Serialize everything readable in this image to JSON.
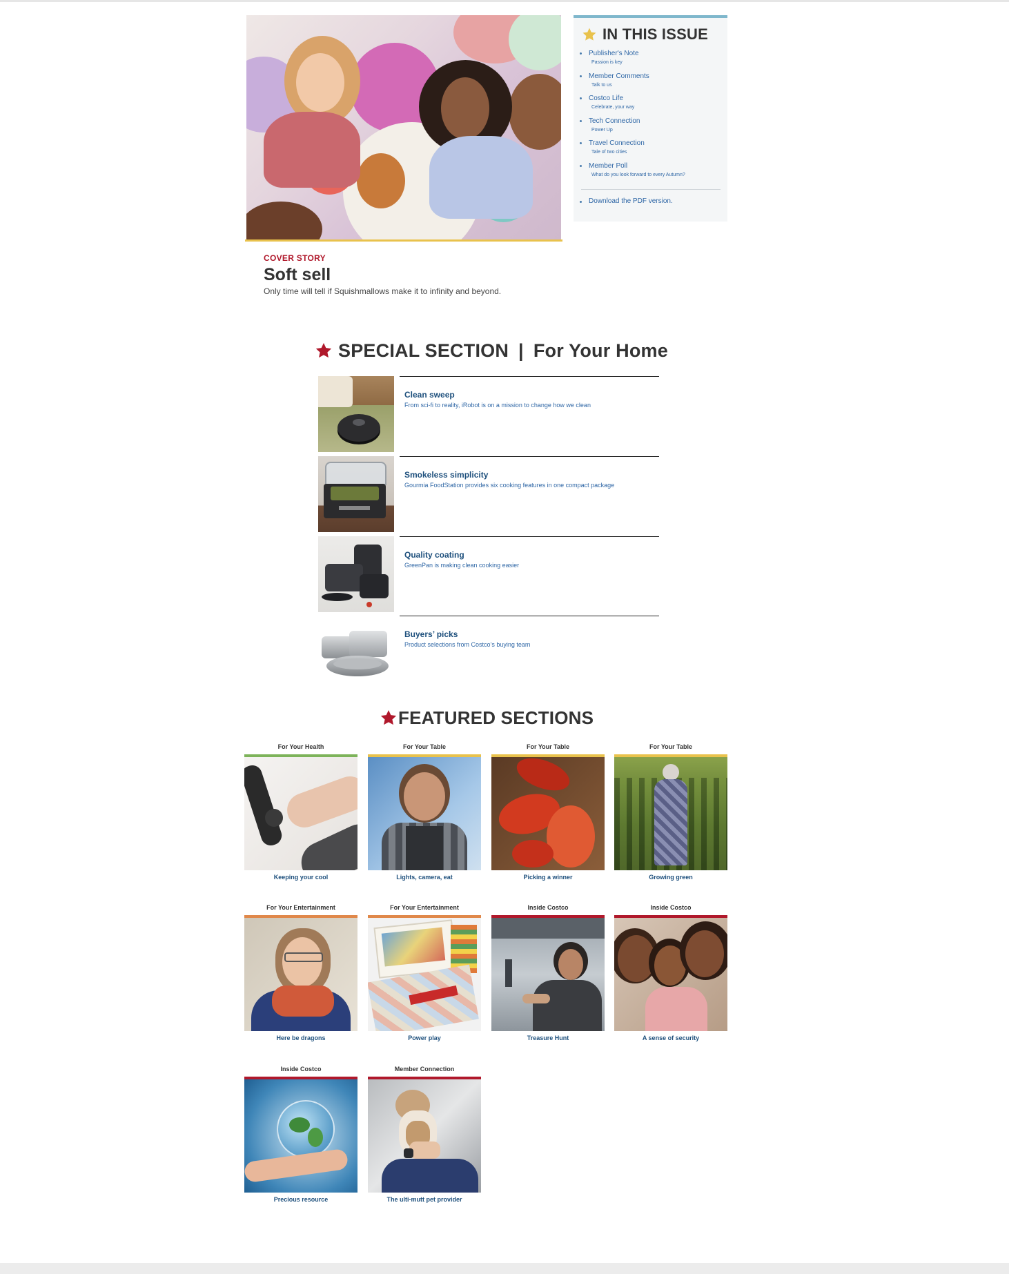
{
  "cover": {
    "label": "COVER STORY",
    "title": "Soft sell",
    "description": "Only time will tell if Squishmallows make it to infinity and beyond."
  },
  "issue": {
    "title": "IN THIS ISSUE",
    "items": [
      {
        "label": "Publisher's Note",
        "sub": "Passion is key"
      },
      {
        "label": "Member Comments",
        "sub": "Talk to us"
      },
      {
        "label": "Costco Life",
        "sub": "Celebrate, your way"
      },
      {
        "label": "Tech Connection",
        "sub": "Power Up"
      },
      {
        "label": "Travel Connection",
        "sub": "Tale of two cities"
      },
      {
        "label": "Member Poll",
        "sub": "What do you look forward to every Autumn?"
      }
    ],
    "pdf_link": "Download the PDF version."
  },
  "special": {
    "title_left": "SPECIAL SECTION",
    "separator": "|",
    "title_right": "For Your Home",
    "items": [
      {
        "title": "Clean sweep",
        "description": "From sci-fi to reality, iRobot is on a mission to change how we clean"
      },
      {
        "title": "Smokeless simplicity",
        "description": "Gourmia FoodStation provides six cooking features in one compact package"
      },
      {
        "title": "Quality coating",
        "description": "GreenPan is making clean cooking easier"
      },
      {
        "title": "Buyers’ picks",
        "description": "Product selections from Costco’s buying team"
      }
    ]
  },
  "featured": {
    "title": "FEATURED SECTIONS",
    "cards": [
      {
        "category": "For Your Health",
        "caption": "Keeping your cool",
        "color": "#7db35a"
      },
      {
        "category": "For Your Table",
        "caption": "Lights, camera, eat",
        "color": "#e9c24c"
      },
      {
        "category": "For Your Table",
        "caption": "Picking a winner",
        "color": "#e9c24c"
      },
      {
        "category": "For Your Table",
        "caption": "Growing green",
        "color": "#e9c24c"
      },
      {
        "category": "For Your Entertainment",
        "caption": "Here be dragons",
        "color": "#e0884a"
      },
      {
        "category": "For Your Entertainment",
        "caption": "Power play",
        "color": "#e0884a"
      },
      {
        "category": "Inside Costco",
        "caption": "Treasure Hunt",
        "color": "#b0182b"
      },
      {
        "category": "Inside Costco",
        "caption": "A sense of security",
        "color": "#b0182b"
      },
      {
        "category": "Inside Costco",
        "caption": "Precious resource",
        "color": "#b0182b"
      },
      {
        "category": "Member Connection",
        "caption": "The ulti-mutt pet provider",
        "color": "#b0182b"
      }
    ]
  },
  "colors": {
    "accent_red": "#b0182b",
    "link_blue": "#2f67a6",
    "title_navy": "#1d4f7c",
    "star_gold": "#e9c24c"
  },
  "icons": {
    "issue_star": "star-icon",
    "section_star": "star-icon"
  }
}
